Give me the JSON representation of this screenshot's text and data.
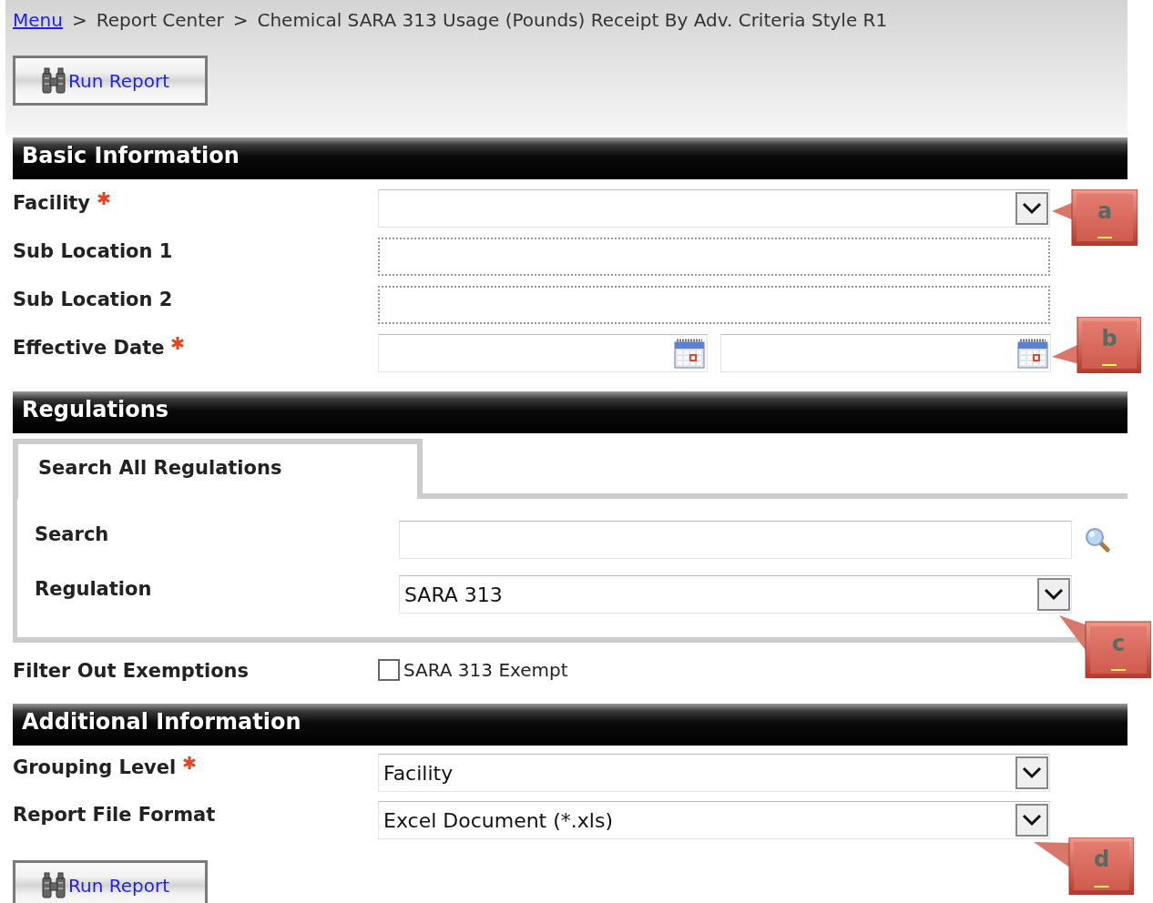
{
  "breadcrumb": [
    {
      "kind": "link",
      "text": "Menu"
    },
    {
      "kind": "separator",
      "text": ">"
    },
    {
      "kind": "text",
      "text": "Report Center"
    },
    {
      "kind": "separator",
      "text": ">"
    },
    {
      "kind": "text",
      "text": "Chemical SARA 313 Usage (Pounds) Receipt By Adv. Criteria Style R1"
    }
  ],
  "top_button": {
    "label": "Run Report"
  },
  "basic_information": {
    "title": "Basic Information",
    "fields": [
      {
        "label": "Facility",
        "required": true,
        "kind": "select",
        "callout": "a"
      },
      {
        "label": "Sub Location 1",
        "required": false,
        "kind": "text",
        "disabled": true
      },
      {
        "label": "Sub Location 2",
        "required": false,
        "kind": "text",
        "disabled": true
      },
      {
        "label": "Effective Date",
        "required": true,
        "kind": "date-range",
        "callout": "b"
      }
    ]
  },
  "regulations": {
    "title": "Regulations",
    "tabs": [
      {
        "label": "Search All Regulations",
        "selected": true
      }
    ],
    "fields": [
      {
        "label": "Search",
        "required": false,
        "kind": "search",
        "disabled": false
      },
      {
        "label": "Regulation",
        "required": false,
        "kind": "select",
        "value": "SARA 313",
        "callout": "c"
      }
    ],
    "filter": {
      "label": "Filter Out Exemptions",
      "kind": "checkbox",
      "option": "SARA 313 Exempt",
      "checked": false
    }
  },
  "additional_information": {
    "title": "Additional Information",
    "fields": [
      {
        "label": "Grouping Level",
        "required": true,
        "kind": "select",
        "value": "Facility"
      },
      {
        "label": "Report File Format",
        "required": false,
        "kind": "select",
        "value": "Excel Document (*.xls)",
        "callout": "d"
      }
    ]
  },
  "bottom_button": {
    "label": "Run Report"
  }
}
